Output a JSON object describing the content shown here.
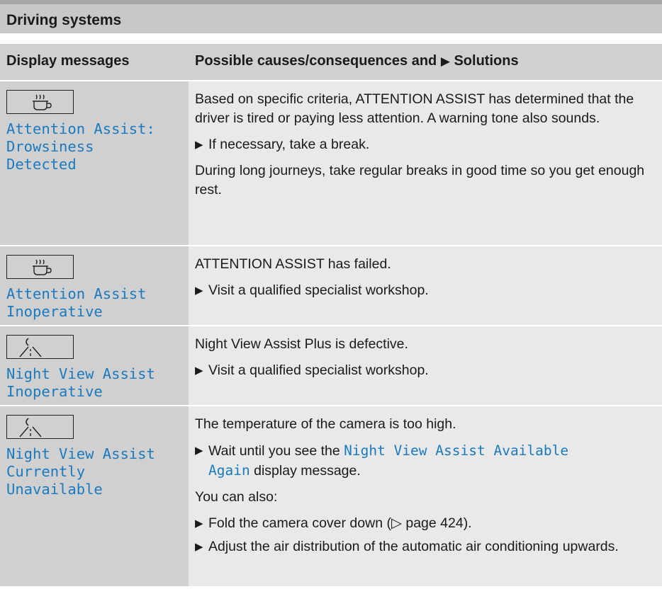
{
  "section": {
    "title": "Driving systems"
  },
  "table": {
    "col1_header": "Display messages",
    "col2_header_prefix": "Possible causes/consequences and",
    "col2_header_suffix": "Solutions"
  },
  "rows": [
    {
      "icon": "coffee-cup-icon",
      "message_lines": [
        "Attention Assist:",
        "Drowsiness",
        "Detected"
      ],
      "content": {
        "p1": "Based on specific criteria, ATTENTION ASSIST has determined that the driver is tired or paying less attention. A warning tone also sounds.",
        "bullet1": "If necessary, take a break.",
        "p2": "During long journeys, take regular breaks in good time so you get enough rest."
      }
    },
    {
      "icon": "coffee-cup-icon",
      "message_lines": [
        "Attention Assist",
        "Inoperative"
      ],
      "content": {
        "p1": "ATTENTION ASSIST has failed.",
        "bullet1": "Visit a qualified specialist workshop."
      }
    },
    {
      "icon": "night-view-icon",
      "message_lines": [
        "Night View Assist",
        "Inoperative"
      ],
      "content": {
        "p1": "Night View Assist Plus is defective.",
        "bullet1": "Visit a qualified specialist workshop."
      }
    },
    {
      "icon": "night-view-icon",
      "message_lines": [
        "Night View Assist",
        "Currently",
        "Unavailable"
      ],
      "content": {
        "p1": "The temperature of the camera is too high.",
        "bullet1_prefix": "Wait until you see the",
        "bullet1_code_line1": "Night View Assist Available",
        "bullet1_code_line2": "Again",
        "bullet1_suffix": "display message.",
        "p2": "You can also:",
        "bullet2": "Fold the camera cover down (▷ page 424).",
        "bullet3": "Adjust the air distribution of the automatic air conditioning upwards."
      }
    }
  ]
}
